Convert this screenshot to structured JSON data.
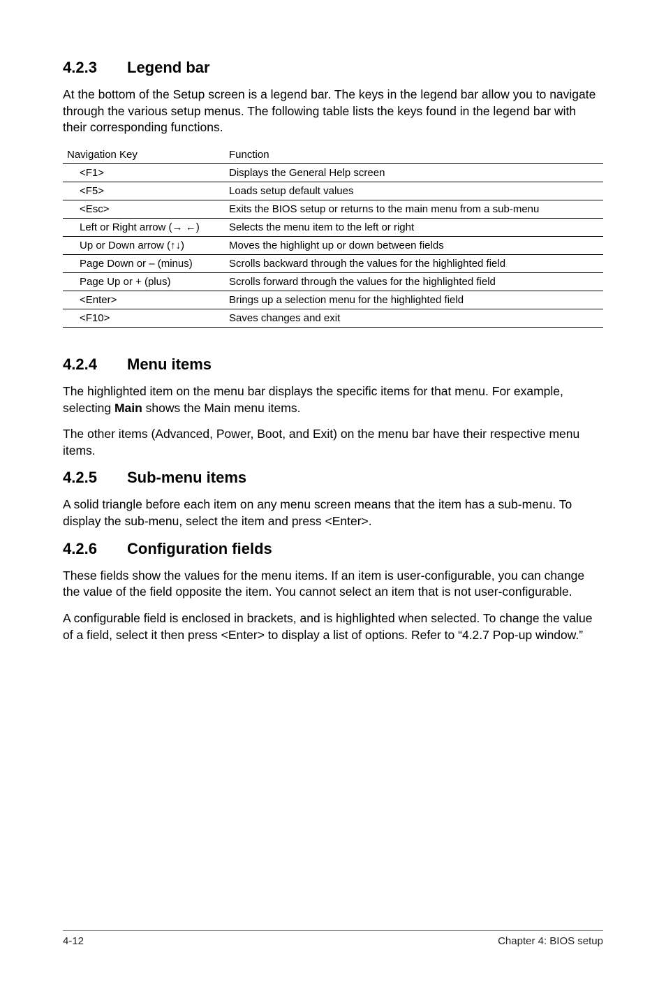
{
  "sections": {
    "s423": {
      "num": "4.2.3",
      "title": "Legend bar",
      "para": "At the bottom of the Setup screen is a legend bar. The keys in the legend bar allow you to navigate through the various setup menus. The following table lists the keys found in the legend bar with their corresponding functions."
    },
    "s424": {
      "num": "4.2.4",
      "title": "Menu items",
      "para1a": "The highlighted item on the menu bar  displays the specific items for that menu. For example, selecting ",
      "para1b": "Main",
      "para1c": " shows the Main menu items.",
      "para2": "The other items (Advanced, Power, Boot, and Exit) on the menu bar have their respective menu items."
    },
    "s425": {
      "num": "4.2.5",
      "title": "Sub-menu items",
      "para": "A solid triangle before each item on any menu screen means that the item has a sub-menu. To display the sub-menu, select the item and press <Enter>."
    },
    "s426": {
      "num": "4.2.6",
      "title": "Configuration fields",
      "para1": "These fields show the values for the menu items. If an item is user-configurable, you can change the value of the field opposite the item. You cannot select an item that is not user-configurable.",
      "para2": "A configurable field is enclosed in brackets, and is highlighted when selected. To change the value of a field, select it then press <Enter> to display a list of options. Refer to “4.2.7 Pop-up window.”"
    }
  },
  "table": {
    "head_key": "Navigation Key",
    "head_func": "Function",
    "rows": [
      {
        "key": "<F1>",
        "func": "Displays the General Help screen"
      },
      {
        "key": "<F5>",
        "func": "Loads setup default values"
      },
      {
        "key": "<Esc>",
        "func": "Exits the BIOS setup or returns to the main menu from a sub-menu"
      },
      {
        "key": "Left or Right arrow (→ ←)",
        "func": "Selects the menu item to the left or right"
      },
      {
        "key": "Up or Down arrow (↑↓)",
        "func": "Moves the highlight up or down between fields"
      },
      {
        "key": "Page Down or – (minus)",
        "func": "Scrolls backward through the values for the highlighted field"
      },
      {
        "key": "Page Up or + (plus)",
        "func": "Scrolls forward through the values for the highlighted field"
      },
      {
        "key": "<Enter>",
        "func": "Brings up a selection menu for the highlighted field"
      },
      {
        "key": "<F10>",
        "func": "Saves changes and exit"
      }
    ]
  },
  "footer": {
    "left": "4-12",
    "right": "Chapter 4: BIOS setup"
  }
}
